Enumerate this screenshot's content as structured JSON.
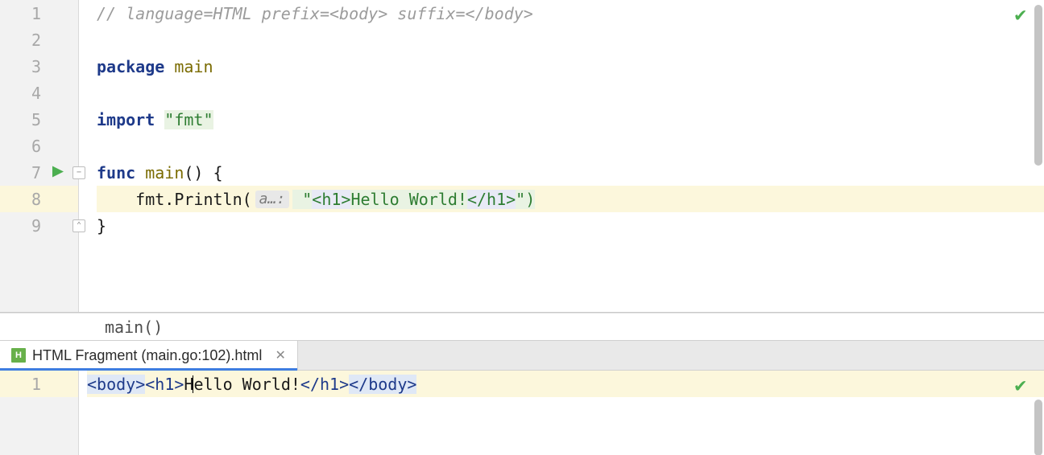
{
  "top_editor": {
    "lines": [
      {
        "n": 1,
        "kind": "comment",
        "text": "// language=HTML prefix=<body> suffix=</body>"
      },
      {
        "n": 2,
        "kind": "blank",
        "text": ""
      },
      {
        "n": 3,
        "kind": "pkg",
        "kw": "package",
        "ident": "main"
      },
      {
        "n": 4,
        "kind": "blank",
        "text": ""
      },
      {
        "n": 5,
        "kind": "imp",
        "kw": "import",
        "str": "\"fmt\""
      },
      {
        "n": 6,
        "kind": "blank",
        "text": ""
      },
      {
        "n": 7,
        "kind": "funcopen",
        "kw": "func",
        "ident": "main",
        "tail": "() {",
        "run": true,
        "fold": true
      },
      {
        "n": 8,
        "kind": "print",
        "indent": "    ",
        "callA": "fmt",
        "callB": ".Println(",
        "hint": "a…:",
        "pre": " \"",
        "tag1": "<h1>",
        "mid": "Hello World!",
        "tag2": "</h1>",
        "post": "\")",
        "current": true
      },
      {
        "n": 9,
        "kind": "close",
        "text": "}",
        "foldUp": true
      }
    ],
    "breadcrumb": "main()",
    "status_ok": true
  },
  "tab": {
    "title": "HTML Fragment (main.go:102).html"
  },
  "bottom_editor": {
    "line_no": 1,
    "seg_body_open": "<body>",
    "seg_h1_open": "<h1>",
    "seg_text_a": "H",
    "seg_text_b": "ello World!",
    "seg_h1_close": "</h1>",
    "seg_body_close": "</body>",
    "current": true,
    "status_ok": true
  }
}
